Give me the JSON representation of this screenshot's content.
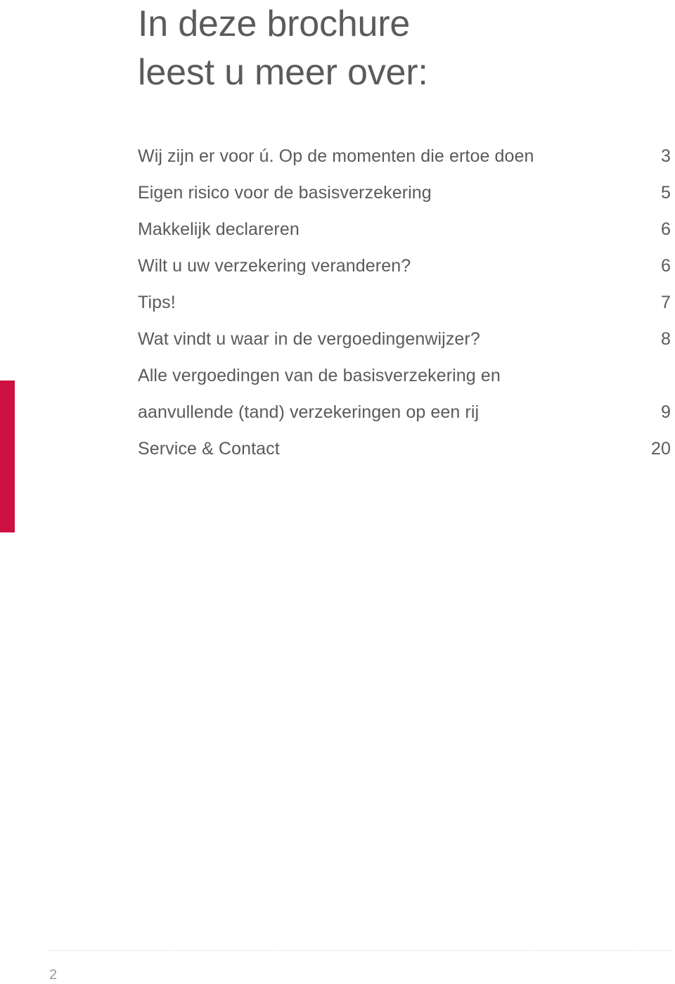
{
  "document": {
    "heading": {
      "line1": "In deze brochure",
      "line2": "leest u meer over:"
    },
    "toc": {
      "entries": [
        {
          "label": "Wij zijn er voor ú. Op de momenten die ertoe doen",
          "page": "3"
        },
        {
          "label": "Eigen risico voor de basisverzekering",
          "page": "5"
        },
        {
          "label": "Makkelijk declareren",
          "page": "6"
        },
        {
          "label": "Wilt u uw verzekering veranderen?",
          "page": "6"
        },
        {
          "label": "Tips!",
          "page": "7"
        },
        {
          "label": "Wat vindt u waar in de vergoedingenwijzer?",
          "page": "8"
        },
        {
          "label_line1": "Alle vergoedingen van de basisverzekering en",
          "label_line2": "aanvullende (tand) verzekeringen op een rij",
          "page": "9"
        },
        {
          "label": "Service & Contact",
          "page": "20"
        }
      ]
    },
    "footer": {
      "page_number": "2"
    },
    "colors": {
      "accent_red": "#ce1143",
      "heading_gray": "#5b5b5b",
      "body_gray": "#5a5a5a",
      "rule_gray": "#b3b3b3",
      "footer_number_gray": "#9a9a9a",
      "background": "#ffffff"
    }
  }
}
